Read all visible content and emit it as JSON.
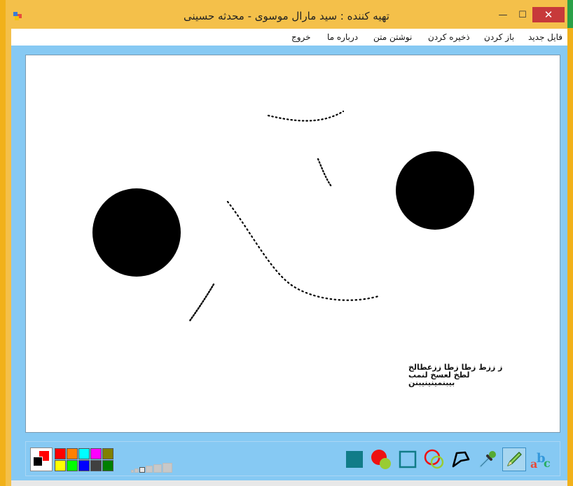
{
  "window": {
    "title": "تهیه کننده : سید مارال موسوی  -  محدثه حسینی",
    "minimize_glyph": "—",
    "maximize_glyph": "☐",
    "close_glyph": "✕"
  },
  "menu": {
    "items": [
      {
        "key": "new",
        "label": "فایل جدید"
      },
      {
        "key": "open",
        "label": "باز کردن"
      },
      {
        "key": "save",
        "label": "ذخیره کردن"
      },
      {
        "key": "text",
        "label": "نوشتن متن"
      },
      {
        "key": "about",
        "label": "درباره ما"
      },
      {
        "key": "exit",
        "label": "خروج"
      }
    ]
  },
  "canvas": {
    "text_line1": "ز ززط زطا زطا ززعطالخ لطخ لعسخ لنمب",
    "text_line2": "بیبنمینینیبنن"
  },
  "palette": {
    "foreground": "#000000",
    "background": "#ff0000",
    "colors": [
      "#ff0000",
      "#ff8000",
      "#00ffff",
      "#ff00ff",
      "#808000",
      "#ffff00",
      "#00ff00",
      "#0000ff",
      "#404040",
      "#008000"
    ]
  },
  "tools": [
    {
      "key": "filled-rect",
      "icon": "filled-rectangle-icon"
    },
    {
      "key": "filled-ellipse",
      "icon": "filled-circle-icon"
    },
    {
      "key": "rect",
      "icon": "rectangle-outline-icon"
    },
    {
      "key": "ellipse",
      "icon": "circle-outline-icon"
    },
    {
      "key": "polygon",
      "icon": "polygon-icon"
    },
    {
      "key": "eyedropper",
      "icon": "eyedropper-icon"
    },
    {
      "key": "pencil",
      "icon": "pencil-icon",
      "active": true
    },
    {
      "key": "text",
      "icon": "abc-text-icon"
    }
  ]
}
